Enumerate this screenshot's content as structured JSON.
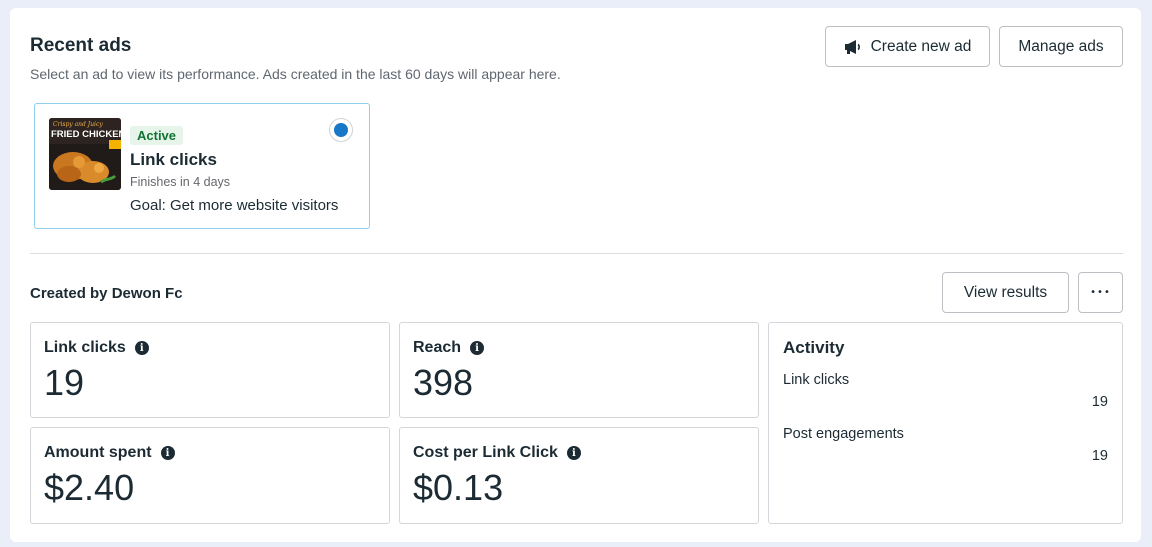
{
  "header": {
    "title": "Recent ads",
    "subtitle": "Select an ad to view its performance. Ads created in the last 60 days will appear here.",
    "create_label": "Create new ad",
    "manage_label": "Manage ads"
  },
  "ad": {
    "thumbnail_text": "Crispy and Juicy FRIED CHICKEN",
    "status": "Active",
    "name": "Link clicks",
    "finishes": "Finishes in 4 days",
    "goal": "Goal: Get more website visitors",
    "selected": true
  },
  "results": {
    "created_by": "Created by Dewon Fc",
    "view_label": "View results",
    "more_label": "•••"
  },
  "stats": [
    {
      "label": "Link clicks",
      "value": "19"
    },
    {
      "label": "Reach",
      "value": "398"
    },
    {
      "label": "Amount spent",
      "value": "$2.40"
    },
    {
      "label": "Cost per Link Click",
      "value": "$0.13"
    }
  ],
  "activity": {
    "title": "Activity",
    "rows": [
      {
        "label": "Link clicks",
        "value": "19"
      },
      {
        "label": "Post engagements",
        "value": "19"
      }
    ]
  },
  "icons": {
    "create": "megaphone-icon",
    "info": "info-icon",
    "more": "more-horizontal-icon"
  },
  "colors": {
    "active_badge_bg": "#e6f4ea",
    "active_badge_text": "#137333",
    "selected_border": "#8fd0ee",
    "radio_selected": "#1877c6"
  }
}
